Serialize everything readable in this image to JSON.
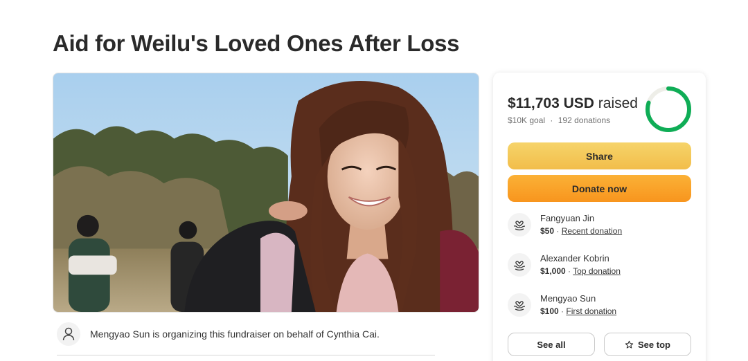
{
  "page": {
    "title": "Aid for Weilu's Loved Ones After Loss"
  },
  "organizer": {
    "text": "Mengyao Sun is organizing this fundraiser on behalf of Cynthia Cai.",
    "icon": "person-icon"
  },
  "summary": {
    "raised_amount": "$11,703 USD",
    "raised_word": "raised",
    "goal": "$10K goal",
    "separator": "·",
    "donations": "192 donations",
    "progress_fraction": 0.8,
    "accent_color": "#0fad56"
  },
  "buttons": {
    "share_label": "Share",
    "donate_label": "Donate now",
    "see_all_label": "See all",
    "see_top_label": "See top",
    "share_color": "#f4c85a",
    "donate_color": "#fba326"
  },
  "donations": [
    {
      "name": "Fangyuan Jin",
      "amount": "$50",
      "tag": "Recent donation",
      "icon": "heart-hands-icon"
    },
    {
      "name": "Alexander Kobrin",
      "amount": "$1,000",
      "tag": "Top donation",
      "icon": "heart-hands-icon"
    },
    {
      "name": "Mengyao Sun",
      "amount": "$100",
      "tag": "First donation",
      "icon": "heart-hands-icon"
    }
  ]
}
